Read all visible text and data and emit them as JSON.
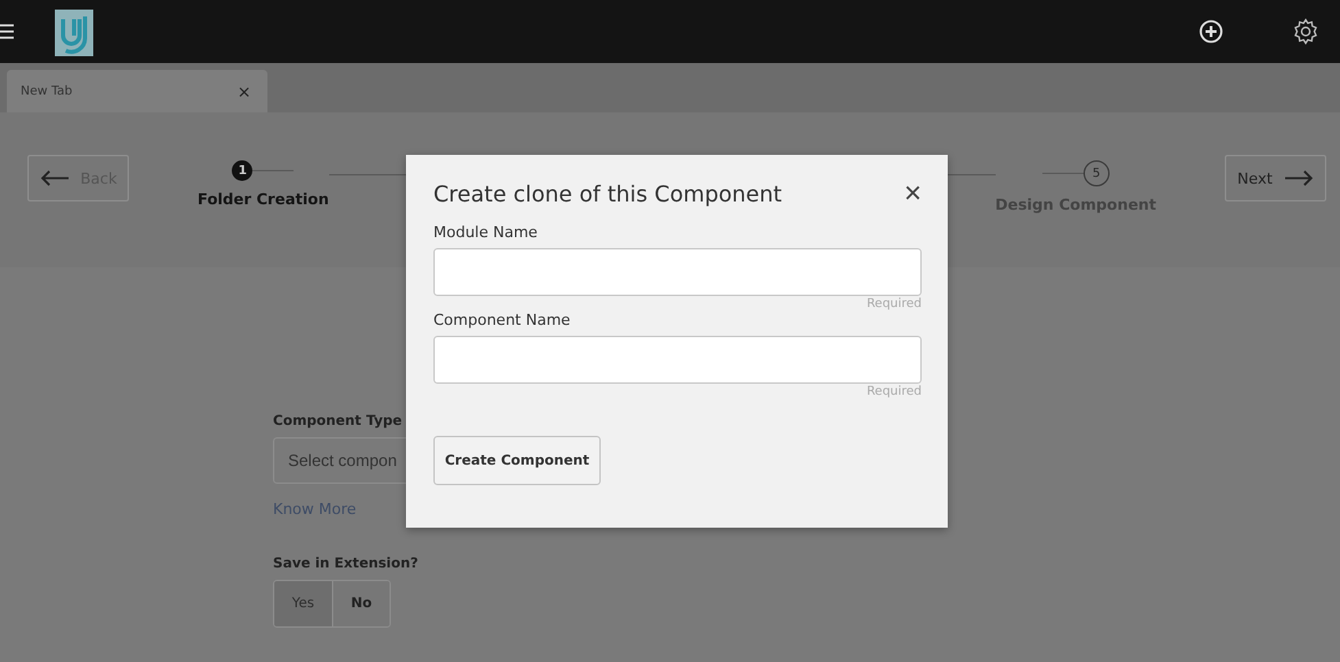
{
  "tabs": [
    {
      "label": "New Tab",
      "close": "×",
      "selected": true
    }
  ],
  "back_button": {
    "label": "Back"
  },
  "next_button": {
    "label": "Next"
  },
  "steps": [
    {
      "number": "1",
      "label": "Folder Creation",
      "selected": true
    },
    {
      "number": "5",
      "label": "Design Component",
      "selected": false
    }
  ],
  "form": {
    "component_type": {
      "label": "Component Type",
      "placeholder": "Select compon"
    },
    "know_more": "Know More",
    "save_in_extension": {
      "label": "Save in Extension?",
      "options": [
        {
          "label": "Yes",
          "selected": false
        },
        {
          "label": "No",
          "selected": true
        }
      ]
    }
  },
  "dialog": {
    "title": "Create clone of this Component",
    "close": "×",
    "fields": [
      {
        "label": "Module Name",
        "hint": "Required"
      },
      {
        "label": "Component Name",
        "hint": "Required"
      }
    ],
    "button": "Create Component"
  }
}
